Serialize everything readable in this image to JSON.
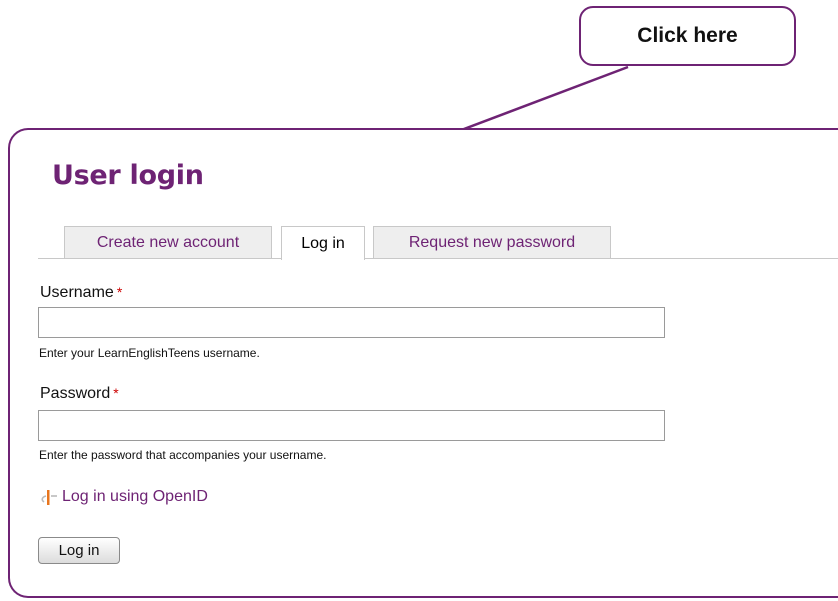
{
  "callout": {
    "label": "Click here"
  },
  "page": {
    "title": "User login"
  },
  "tabs": [
    {
      "label": "Create new account",
      "active": false
    },
    {
      "label": "Log in",
      "active": true
    },
    {
      "label": "Request new password",
      "active": false
    }
  ],
  "form": {
    "username": {
      "label": "Username",
      "required_mark": "*",
      "value": "",
      "description": "Enter your LearnEnglishTeens username."
    },
    "password": {
      "label": "Password",
      "required_mark": "*",
      "value": "",
      "description": "Enter the password that accompanies your username."
    },
    "openid_link": "Log in using OpenID",
    "submit_label": "Log in"
  },
  "colors": {
    "accent": "#6e2374",
    "required": "#cc0000",
    "tab_inactive_bg": "#eeeeee"
  }
}
